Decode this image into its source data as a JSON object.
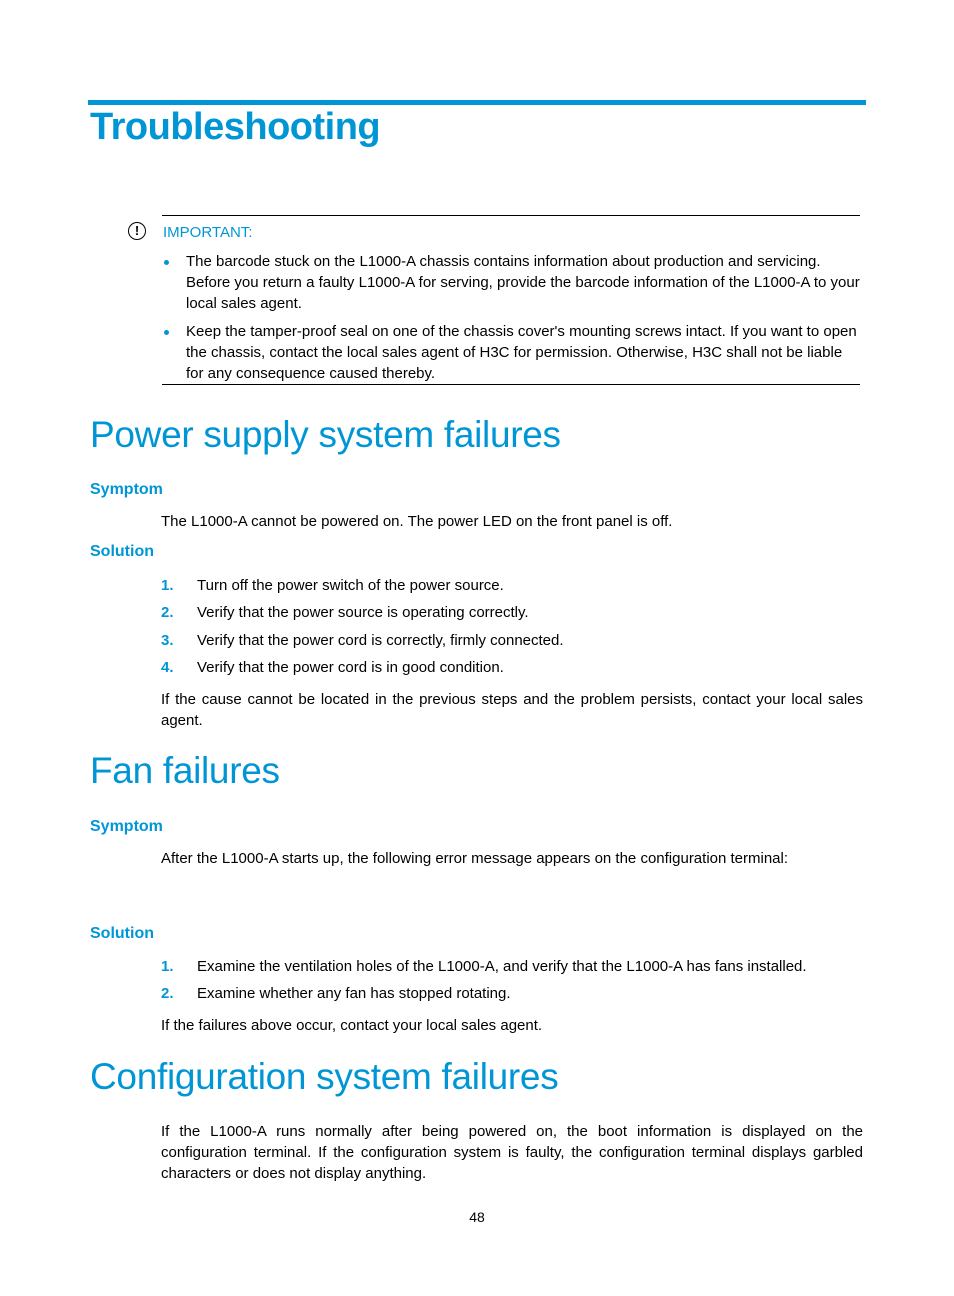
{
  "chapter": {
    "title": "Troubleshooting"
  },
  "important_note": {
    "icon": "exclamation-circle-icon",
    "label": "IMPORTANT:",
    "bullets": [
      "The barcode stuck on the L1000-A chassis contains information about production and servicing. Before you return a faulty L1000-A for serving, provide the barcode information of the L1000-A to your local sales agent.",
      "Keep the tamper-proof seal on one of the chassis cover's mounting screws intact. If you want to open the chassis, contact the local sales agent of H3C for permission. Otherwise, H3C shall not be liable for any consequence caused thereby."
    ]
  },
  "sections": [
    {
      "title": "Power supply system failures",
      "symptom_heading": "Symptom",
      "symptom_text": "The L1000-A cannot be powered on. The power LED on the front panel is off.",
      "solution_heading": "Solution",
      "steps": [
        {
          "num": "1.",
          "text": "Turn off the power switch of the power source."
        },
        {
          "num": "2.",
          "text": "Verify that the power source is operating correctly."
        },
        {
          "num": "3.",
          "text": "Verify that the power cord is correctly, firmly connected."
        },
        {
          "num": "4.",
          "text": "Verify that the power cord is in good condition."
        }
      ],
      "closing": "If the cause cannot be located in the previous steps and the problem persists, contact your local sales agent."
    },
    {
      "title": "Fan failures",
      "symptom_heading": "Symptom",
      "symptom_text": "After the L1000-A starts up, the following error message appears on the configuration terminal:",
      "solution_heading": "Solution",
      "steps": [
        {
          "num": "1.",
          "text": "Examine the ventilation holes of the L1000-A, and verify that the L1000-A has fans installed."
        },
        {
          "num": "2.",
          "text": "Examine whether any fan has stopped rotating."
        }
      ],
      "closing": "If the failures above occur, contact your local sales agent."
    },
    {
      "title": "Configuration system failures",
      "body": "If the L1000-A runs normally after being powered on, the boot information is displayed on the configuration terminal. If the configuration system is faulty, the configuration terminal displays garbled characters or does not display anything."
    }
  ],
  "footer": {
    "page_number": "48"
  }
}
